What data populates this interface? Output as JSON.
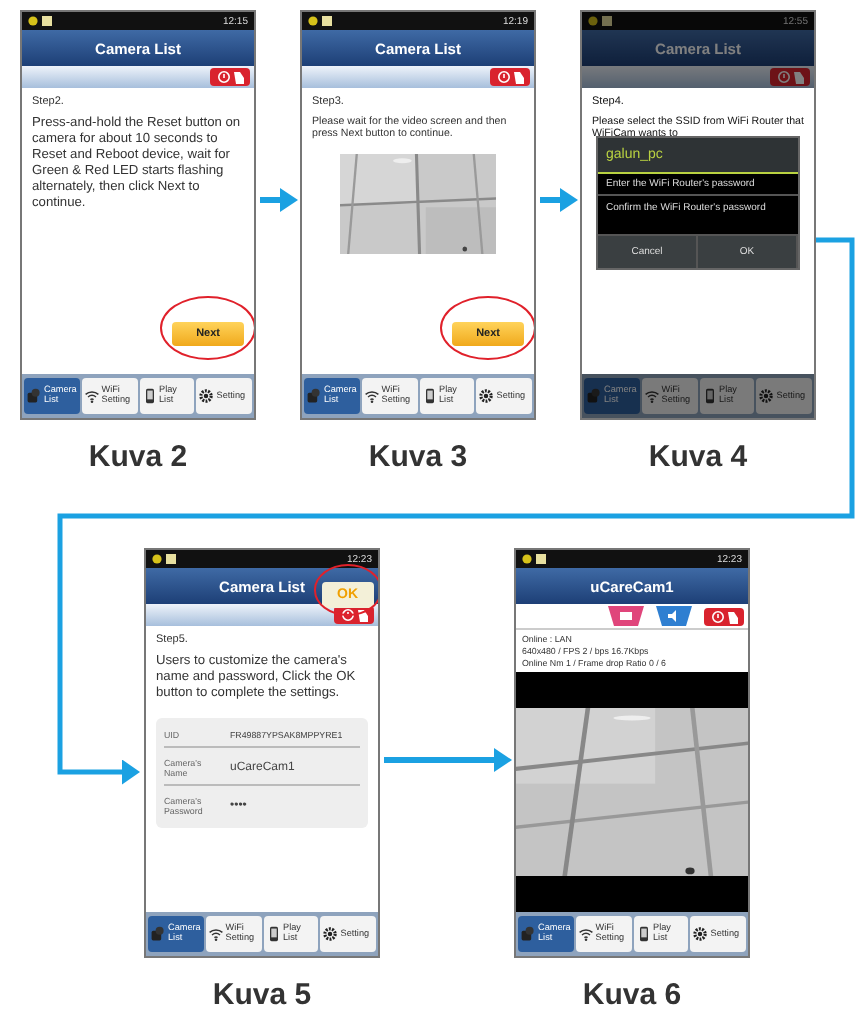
{
  "screens": [
    {
      "caption": "Kuva 2",
      "time": "12:15",
      "title": "Camera List",
      "kind": "instruction",
      "step": "Step2.",
      "text": "Press-and-hold the Reset button on camera for about 10 seconds to Reset and Reboot device, wait for Green & Red LED starts flashing alternately, then click Next to continue.",
      "next": {
        "label": "Next",
        "highlighted": true
      },
      "tabs": [
        {
          "label": "Camera List",
          "kind": "camera",
          "selected": true
        },
        {
          "label": "WiFi Setting",
          "kind": "wifi",
          "selected": false
        },
        {
          "label": "Play List",
          "kind": "playlist",
          "selected": false
        },
        {
          "label": "Setting",
          "kind": "setting",
          "selected": false
        }
      ]
    },
    {
      "caption": "Kuva 3",
      "time": "12:19",
      "title": "Camera List",
      "kind": "video_step",
      "step": "Step3.",
      "text": "Please wait for the video screen and then press Next button to continue.",
      "next": {
        "label": "Next",
        "highlighted": true
      },
      "tabs": [
        {
          "label": "Camera List",
          "kind": "camera",
          "selected": true
        },
        {
          "label": "WiFi Setting",
          "kind": "wifi",
          "selected": false
        },
        {
          "label": "Play List",
          "kind": "playlist",
          "selected": false
        },
        {
          "label": "Setting",
          "kind": "setting",
          "selected": false
        }
      ]
    },
    {
      "caption": "Kuva 4",
      "time": "12:55",
      "title": "Camera List",
      "kind": "dialog",
      "step": "Step4.",
      "text": "Please select the SSID from WiFi Router that WiFiCam wants to",
      "dialog": {
        "title": "galun_pc",
        "fields": [
          {
            "placeholder": "Enter the WiFi Router's password"
          },
          {
            "placeholder": "Confirm the WiFi Router's password"
          }
        ],
        "buttons": [
          "Cancel",
          "OK"
        ]
      },
      "tabs": [
        {
          "label": "Camera List",
          "kind": "camera",
          "selected": true
        },
        {
          "label": "WiFi Setting",
          "kind": "wifi",
          "selected": false
        },
        {
          "label": "Play List",
          "kind": "playlist",
          "selected": false
        },
        {
          "label": "Setting",
          "kind": "setting",
          "selected": false
        }
      ]
    },
    {
      "caption": "Kuva 5",
      "time": "12:23",
      "title": "Camera List",
      "kind": "form",
      "title_button": {
        "label": "OK",
        "highlighted": true
      },
      "step": "Step5.",
      "text": "Users to customize the camera's name and password, Click the OK button to complete the settings.",
      "fields": [
        {
          "label": "UID",
          "value": "FR49887YPSAK8MPPYRE1"
        },
        {
          "label": "Camera's Name",
          "value": "uCareCam1"
        },
        {
          "label": "Camera's Password",
          "value": "••••"
        }
      ],
      "tabs": [
        {
          "label": "Camera List",
          "kind": "camera",
          "selected": true
        },
        {
          "label": "WiFi Setting",
          "kind": "wifi",
          "selected": false
        },
        {
          "label": "Play List",
          "kind": "playlist",
          "selected": false
        },
        {
          "label": "Setting",
          "kind": "setting",
          "selected": false
        }
      ]
    },
    {
      "caption": "Kuva 6",
      "time": "12:23",
      "title": "uCareCam1",
      "kind": "live",
      "info": [
        "Online : LAN",
        "640x480 / FPS 2 / bps 16.7Kbps",
        "Online Nm 1 / Frame drop Ratio 0 / 6"
      ],
      "tabs": [
        {
          "label": "Camera List",
          "kind": "camera",
          "selected": true
        },
        {
          "label": "WiFi Setting",
          "kind": "wifi",
          "selected": false
        },
        {
          "label": "Play List",
          "kind": "playlist",
          "selected": false
        },
        {
          "label": "Setting",
          "kind": "setting",
          "selected": false
        }
      ]
    }
  ]
}
